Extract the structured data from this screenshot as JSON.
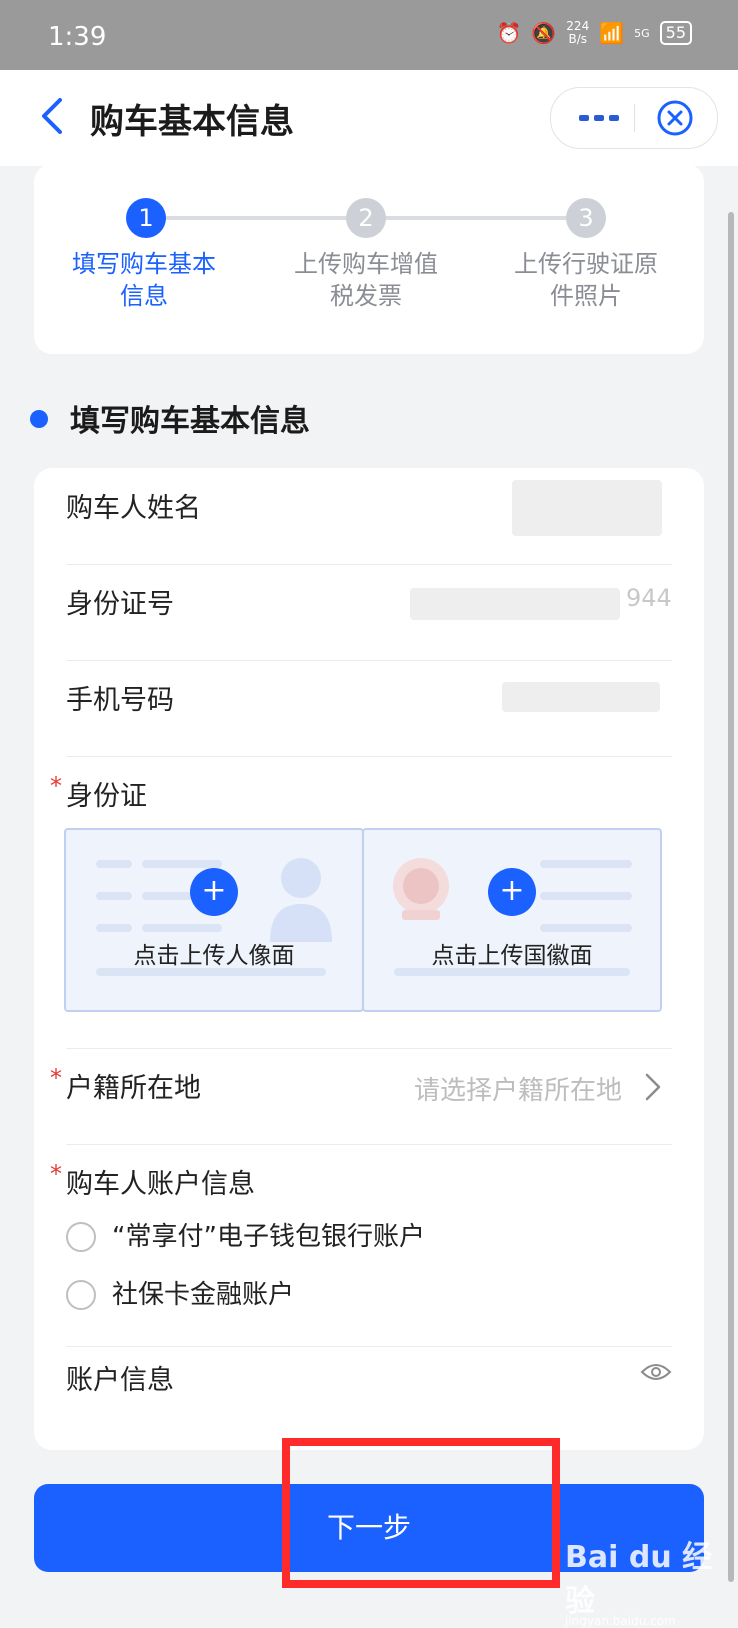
{
  "status": {
    "time": "1:39",
    "net_speed": "224",
    "net_unit": "B/s",
    "signal": "5G",
    "battery": "55"
  },
  "header": {
    "title": "购车基本信息",
    "back_icon": "back-arrow-icon",
    "more_icon": "more-dots-icon",
    "close_icon": "mini-close-icon"
  },
  "steps": [
    {
      "num": "1",
      "label": "填写购车基本信息",
      "active": true
    },
    {
      "num": "2",
      "label": "上传购车增值税发票",
      "active": false
    },
    {
      "num": "3",
      "label": "上传行驶证原件照片",
      "active": false
    }
  ],
  "section": {
    "title": "填写购车基本信息"
  },
  "form": {
    "buyer_name_label": "购车人姓名",
    "id_number_label": "身份证号",
    "id_number_visible_tail": "944",
    "phone_label": "手机号码",
    "id_card_label": "身份证",
    "required_mark": "*",
    "upload_portrait": "点击上传人像面",
    "upload_emblem": "点击上传国徽面",
    "upload_plus": "+",
    "household_label": "户籍所在地",
    "household_placeholder": "请选择户籍所在地",
    "account_label": "购车人账户信息",
    "account_options": [
      "“常享付”电子钱包银行账户",
      "社保卡金融账户"
    ],
    "account_info_label": "账户信息"
  },
  "actions": {
    "next": "下一步"
  },
  "watermark": {
    "brand": "Bai du 经验",
    "url": "jingyan.baidu.com"
  },
  "colors": {
    "accent": "#1a61ff",
    "required": "#e53935",
    "highlight": "#ff2a2a"
  }
}
